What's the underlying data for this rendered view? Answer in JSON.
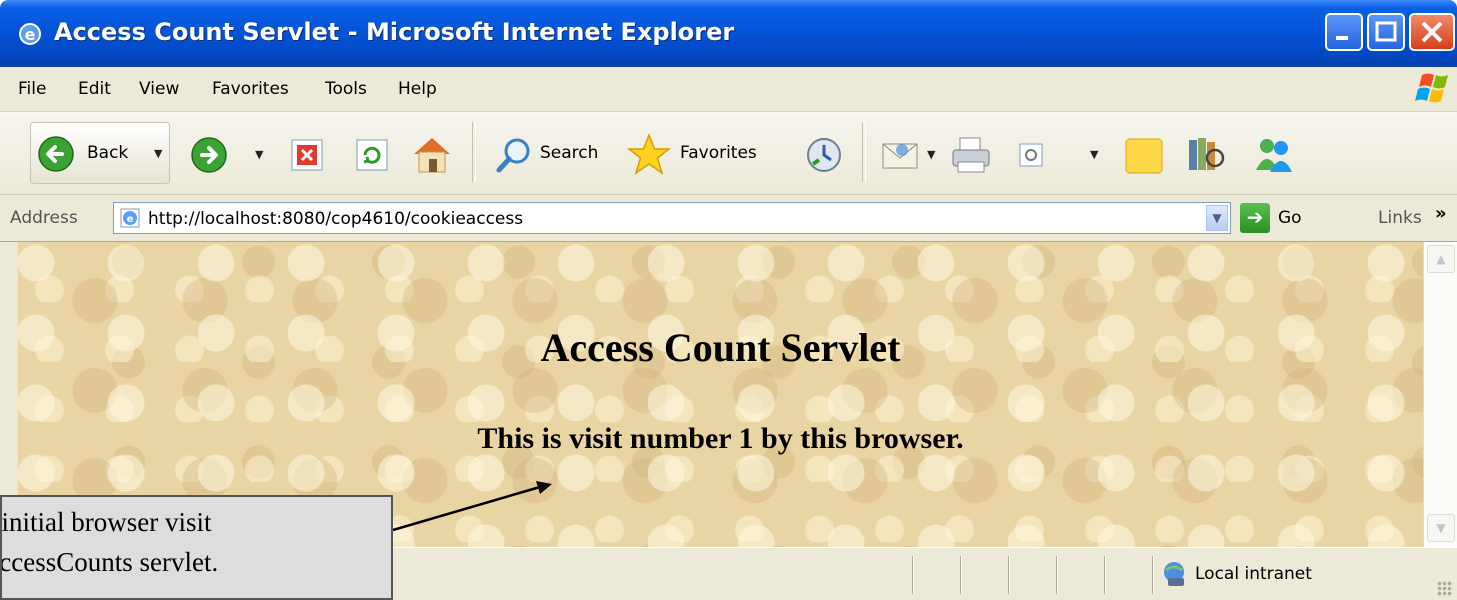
{
  "window": {
    "title": "Access Count Servlet - Microsoft Internet Explorer"
  },
  "menu": [
    "File",
    "Edit",
    "View",
    "Favorites",
    "Tools",
    "Help"
  ],
  "toolbar": {
    "back_label": "Back",
    "search_label": "Search",
    "favorites_label": "Favorites"
  },
  "address": {
    "label": "Address",
    "url": "http://localhost:8080/cop4610/cookieaccess",
    "go_label": "Go",
    "links_label": "Links"
  },
  "page": {
    "heading": "Access Count Servlet",
    "message": "This is visit number 1 by this browser."
  },
  "status": {
    "zone": "Local intranet"
  },
  "callout": {
    "line1": "Results of initial browser visit",
    "line2": "to ClientAccessCounts servlet."
  },
  "colors": {
    "titlebar": "#0553d6",
    "chrome": "#ece9d8",
    "page_background": "#e9d4a3",
    "callout_background": "#dddddd"
  }
}
